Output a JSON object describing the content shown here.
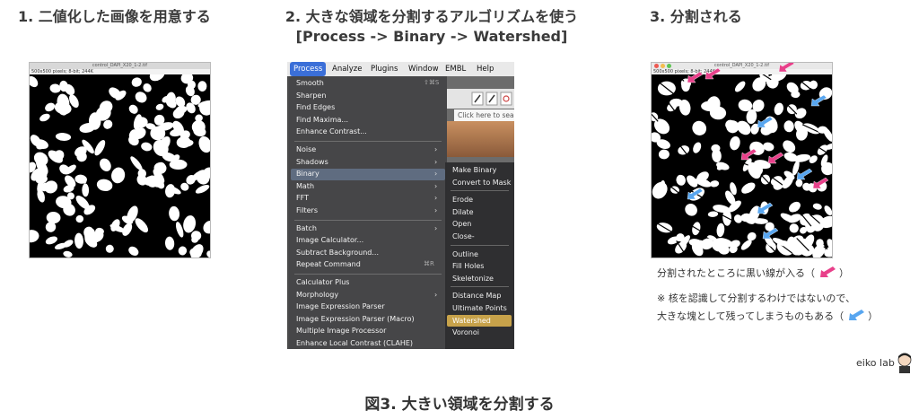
{
  "steps": {
    "step1": "1. 二値化した画像を用意する",
    "step2_line1": "2. 大きな領域を分割するアルゴリズムを使う",
    "step2_line2": "[Process -> Binary -> Watershed]",
    "step3": "3. 分割される"
  },
  "image_windows": {
    "left": {
      "title": "control_DAPI_X20_1-2.tif",
      "info": "500x500 pixels; 8-bit; 244K"
    },
    "right": {
      "title": "control_DAPI_X20_1-2.tif",
      "info": "500x500 pixels; 8-bit; 244K"
    }
  },
  "menubar": [
    "Process",
    "Analyze",
    "Plugins",
    "Window",
    "EMBL",
    "Help"
  ],
  "search_placeholder": "Click here to sea",
  "process_menu": [
    {
      "label": "Smooth",
      "shortcut": "⇧⌘S"
    },
    {
      "label": "Sharpen"
    },
    {
      "label": "Find Edges"
    },
    {
      "label": "Find Maxima..."
    },
    {
      "label": "Enhance Contrast..."
    },
    {
      "label": "Noise",
      "submenu": true
    },
    {
      "label": "Shadows",
      "submenu": true
    },
    {
      "label": "Binary",
      "submenu": true,
      "highlighted": true
    },
    {
      "label": "Math",
      "submenu": true
    },
    {
      "label": "FFT",
      "submenu": true
    },
    {
      "label": "Filters",
      "submenu": true
    },
    {
      "label": "Batch",
      "submenu": true
    },
    {
      "label": "Image Calculator..."
    },
    {
      "label": "Subtract Background..."
    },
    {
      "label": "Repeat Command",
      "shortcut": "⌘R"
    },
    {
      "label": "Calculator Plus"
    },
    {
      "label": "Morphology",
      "submenu": true
    },
    {
      "label": "Image Expression Parser"
    },
    {
      "label": "Image Expression Parser (Macro)"
    },
    {
      "label": "Multiple Image Processor"
    },
    {
      "label": "Enhance Local Contrast (CLAHE)"
    }
  ],
  "binary_submenu": [
    "Make Binary",
    "Convert to Mask",
    "Erode",
    "Dilate",
    "Open",
    "Close-",
    "Outline",
    "Fill Holes",
    "Skeletonize",
    "Distance Map",
    "Ultimate Points",
    "Watershed",
    "Voronoi"
  ],
  "notes": {
    "note1": "分割されたところに黒い線が入る（",
    "note1_end": "）",
    "note2_line1": "※ 核を認識して分割するわけではないので、",
    "note2_line2": "大きな塊として残ってしまうものもある（",
    "note2_end": "）"
  },
  "colors": {
    "pink_arrow": "#e8408a",
    "blue_arrow": "#58a6f0",
    "watershed_highlight": "#c7a24a"
  },
  "logo": "eiko lab",
  "caption": "図3. 大きい領域を分割する"
}
